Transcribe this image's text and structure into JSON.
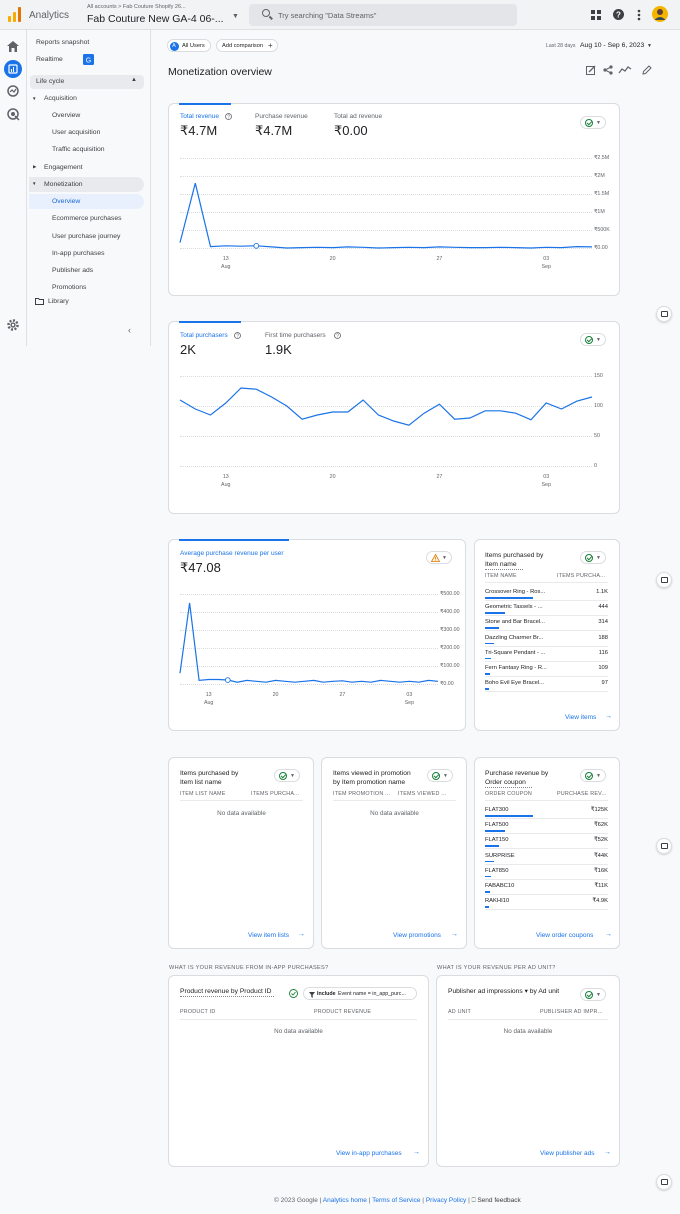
{
  "header": {
    "app_name": "Analytics",
    "breadcrumb": "All accounts > Fab Couture Shopify 26...",
    "property_name": "Fab Couture New GA-4 06-...",
    "search_placeholder": "Try searching \"Data Streams\""
  },
  "sidenav": {
    "reports_snapshot": "Reports snapshot",
    "realtime": "Realtime",
    "lifecycle": "Life cycle",
    "acquisition": "Acquisition",
    "acq_overview": "Overview",
    "user_acquisition": "User acquisition",
    "traffic_acquisition": "Traffic acquisition",
    "engagement": "Engagement",
    "monetization": "Monetization",
    "mon_overview": "Overview",
    "ecommerce_purchases": "Ecommerce purchases",
    "user_purchase_journey": "User purchase journey",
    "in_app_purchases": "In-app purchases",
    "publisher_ads": "Publisher ads",
    "promotions": "Promotions",
    "library": "Library"
  },
  "filters": {
    "all_users_badge": "A",
    "all_users": "All Users",
    "add_comparison": "Add comparison",
    "period_label": "Last 28 days",
    "date_range": "Aug 10 - Sep 6, 2023"
  },
  "page_title": "Monetization overview",
  "revenue_card": {
    "metrics": [
      {
        "label": "Total revenue",
        "value": "₹4.7M"
      },
      {
        "label": "Purchase revenue",
        "value": "₹4.7M"
      },
      {
        "label": "Total ad revenue",
        "value": "₹0.00"
      }
    ],
    "y_ticks": [
      "₹2.5M",
      "₹2M",
      "₹1.5M",
      "₹1M",
      "₹500K",
      "₹0.00"
    ],
    "x_ticks": [
      "13",
      "20",
      "27",
      "03"
    ],
    "x_months": [
      "Aug",
      "Sep"
    ]
  },
  "purchasers_card": {
    "metrics": [
      {
        "label": "Total purchasers",
        "value": "2K"
      },
      {
        "label": "First time purchasers",
        "value": "1.9K"
      }
    ],
    "y_ticks": [
      "150",
      "100",
      "50",
      "0"
    ],
    "x_ticks": [
      "13",
      "20",
      "27",
      "03"
    ],
    "x_months": [
      "Aug",
      "Sep"
    ]
  },
  "arpu_card": {
    "label": "Average purchase revenue per user",
    "value": "₹47.08",
    "y_ticks": [
      "₹500.00",
      "₹400.00",
      "₹300.00",
      "₹200.00",
      "₹100.00",
      "₹0.00"
    ],
    "x_ticks": [
      "13",
      "20",
      "27",
      "03"
    ],
    "x_months": [
      "Aug",
      "Sep"
    ]
  },
  "items_card": {
    "title_line1": "Items purchased by",
    "title_line2": "Item name",
    "col1": "ITEM NAME",
    "col2": "ITEMS PURCHA...",
    "rows": [
      {
        "name": "Crossover Ring - Ros...",
        "value": "1.1K"
      },
      {
        "name": "Geometric Tassels - ...",
        "value": "444"
      },
      {
        "name": "Stone and Bar Bracel...",
        "value": "314"
      },
      {
        "name": "Dazzling Charmer Br...",
        "value": "188"
      },
      {
        "name": "Tri-Square Pendant - ...",
        "value": "116"
      },
      {
        "name": "Fern Fantasy Ring - R...",
        "value": "109"
      },
      {
        "name": "Boho Evil Eye Bracel...",
        "value": "97"
      }
    ],
    "link": "View items"
  },
  "item_list_card": {
    "title_line1": "Items purchased by",
    "title_line2": "Item list name",
    "col1": "ITEM LIST NAME",
    "col2": "ITEMS PURCHA...",
    "no_data": "No data available",
    "link": "View item lists"
  },
  "promotion_card": {
    "title_line1": "Items viewed in promotion",
    "title_line2": "by Item promotion name",
    "col1": "ITEM PROMOTION ...",
    "col2": "ITEMS VIEWED ...",
    "no_data": "No data available",
    "link": "View promotions"
  },
  "coupon_card": {
    "title_line1": "Purchase revenue by",
    "title_line2": "Order coupon",
    "col1": "ORDER COUPON",
    "col2": "PURCHASE REV...",
    "rows": [
      {
        "name": "FLAT300",
        "value": "₹125K"
      },
      {
        "name": "FLAT500",
        "value": "₹62K"
      },
      {
        "name": "FLAT150",
        "value": "₹52K"
      },
      {
        "name": "SURPRISE",
        "value": "₹44K"
      },
      {
        "name": "FLAT850",
        "value": "₹16K"
      },
      {
        "name": "FABABC10",
        "value": "₹11K"
      },
      {
        "name": "RAKHI10",
        "value": "₹4.9K"
      }
    ],
    "link": "View order coupons"
  },
  "inapp_section": {
    "question": "WHAT IS YOUR REVENUE FROM IN-APP PURCHASES?",
    "title": "Product revenue by Product ID",
    "filter_include": "Include",
    "filter_text": "Event name = in_app_purc...",
    "col1": "PRODUCT ID",
    "col2": "PRODUCT REVENUE",
    "no_data": "No data available",
    "link": "View in-app purchases"
  },
  "adunit_section": {
    "question": "WHAT IS YOUR REVENUE PER AD UNIT?",
    "title": "Publisher ad impressions ▾ by Ad unit",
    "col1": "AD UNIT",
    "col2": "PUBLISHER AD IMPR...",
    "no_data": "No data available",
    "link": "View publisher ads"
  },
  "footer": {
    "copyright": "© 2023 Google |",
    "analytics_home": "Analytics home",
    "terms": "Terms of Service",
    "privacy": "Privacy Policy",
    "feedback": "Send feedback"
  },
  "chart_data": [
    {
      "type": "line",
      "name": "Total revenue",
      "x": [
        "Aug 10",
        "Aug 11",
        "Aug 12",
        "Aug 13",
        "Aug 14",
        "Aug 15",
        "Aug 16",
        "Aug 17",
        "Aug 18",
        "Aug 19",
        "Aug 20",
        "Aug 21",
        "Aug 22",
        "Aug 23",
        "Aug 24",
        "Aug 25",
        "Aug 26",
        "Aug 27",
        "Aug 28",
        "Aug 29",
        "Aug 30",
        "Aug 31",
        "Sep 1",
        "Sep 2",
        "Sep 3",
        "Sep 4",
        "Sep 5",
        "Sep 6"
      ],
      "values": [
        150000,
        1800000,
        40000,
        60000,
        50000,
        60000,
        30000,
        0,
        10000,
        20000,
        10000,
        30000,
        20000,
        0,
        10000,
        20000,
        10000,
        30000,
        20000,
        10000,
        10000,
        20000,
        10000,
        0,
        20000,
        10000,
        40000,
        30000
      ],
      "ylim": [
        0,
        2500000
      ],
      "y_ticks": [
        "₹2.5M",
        "₹2M",
        "₹1.5M",
        "₹1M",
        "₹500K",
        "₹0.00"
      ]
    },
    {
      "type": "line",
      "name": "Total purchasers",
      "x": [
        "Aug 10",
        "Aug 11",
        "Aug 12",
        "Aug 13",
        "Aug 14",
        "Aug 15",
        "Aug 16",
        "Aug 17",
        "Aug 18",
        "Aug 19",
        "Aug 20",
        "Aug 21",
        "Aug 22",
        "Aug 23",
        "Aug 24",
        "Aug 25",
        "Aug 26",
        "Aug 27",
        "Aug 28",
        "Aug 29",
        "Aug 30",
        "Aug 31",
        "Sep 1",
        "Sep 2",
        "Sep 3",
        "Sep 4",
        "Sep 5",
        "Sep 6"
      ],
      "values": [
        110,
        95,
        85,
        105,
        130,
        128,
        115,
        100,
        78,
        85,
        90,
        90,
        110,
        85,
        75,
        68,
        88,
        103,
        78,
        80,
        92,
        92,
        88,
        77,
        105,
        95,
        108,
        115
      ],
      "ylim": [
        0,
        150
      ],
      "y_ticks": [
        "150",
        "100",
        "50",
        "0"
      ]
    },
    {
      "type": "line",
      "name": "Average purchase revenue per user",
      "x": [
        "Aug 10",
        "Aug 11",
        "Aug 12",
        "Aug 13",
        "Aug 14",
        "Aug 15",
        "Aug 16",
        "Aug 17",
        "Aug 18",
        "Aug 19",
        "Aug 20",
        "Aug 21",
        "Aug 22",
        "Aug 23",
        "Aug 24",
        "Aug 25",
        "Aug 26",
        "Aug 27",
        "Aug 28",
        "Aug 29",
        "Aug 30",
        "Aug 31",
        "Sep 1",
        "Sep 2",
        "Sep 3",
        "Sep 4",
        "Sep 5",
        "Sep 6"
      ],
      "values": [
        60,
        450,
        20,
        25,
        25,
        22,
        10,
        20,
        15,
        10,
        20,
        15,
        10,
        15,
        20,
        10,
        15,
        18,
        10,
        15,
        10,
        20,
        15,
        10,
        15,
        10,
        20,
        15
      ],
      "ylim": [
        0,
        500
      ],
      "y_ticks": [
        "₹500.00",
        "₹400.00",
        "₹300.00",
        "₹200.00",
        "₹100.00",
        "₹0.00"
      ]
    }
  ]
}
